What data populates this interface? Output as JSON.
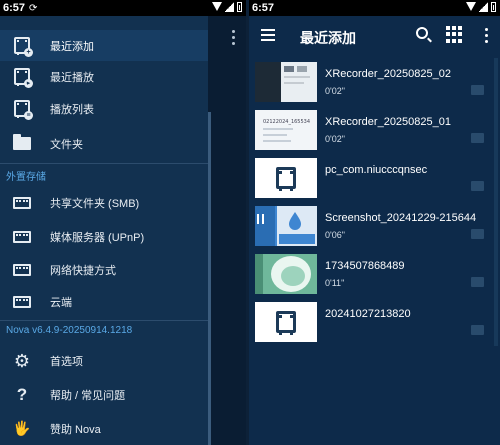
{
  "left_status": {
    "time": "6:57",
    "sync": "⟳"
  },
  "right_status": {
    "time": "6:57"
  },
  "drawer": {
    "items": [
      {
        "label": "最近添加",
        "icon": "recent-add-icon",
        "active": true
      },
      {
        "label": "最近播放",
        "icon": "recent-play-icon",
        "active": false
      },
      {
        "label": "播放列表",
        "icon": "playlist-icon",
        "active": false
      },
      {
        "label": "文件夹",
        "icon": "folder-icon",
        "active": false
      }
    ],
    "external_section": "外置存储",
    "external_items": [
      {
        "label": "共享文件夹 (SMB)",
        "icon": "smb-icon"
      },
      {
        "label": "媒体服务器 (UPnP)",
        "icon": "upnp-icon"
      },
      {
        "label": "网络快捷方式",
        "icon": "network-shortcut-icon"
      },
      {
        "label": "云端",
        "icon": "cloud-icon"
      }
    ],
    "version": "Nova v6.4.9-20250914.1218",
    "bottom_items": [
      {
        "label": "首选项",
        "icon": "gear-icon"
      },
      {
        "label": "帮助 / 常见问题",
        "icon": "help-icon"
      },
      {
        "label": "赞助 Nova",
        "icon": "donate-icon"
      }
    ]
  },
  "appbar": {
    "title": "最近添加"
  },
  "media": [
    {
      "title": "XRecorder_20250825_02",
      "duration": "0'02\"",
      "thumb": "phone-screen"
    },
    {
      "title": "XRecorder_20250825_01",
      "duration": "0'02\"",
      "thumb": "document",
      "thumb_text": "02122024_165534"
    },
    {
      "title": "pc_com.niucccqnsec",
      "duration": "",
      "thumb": "video-placeholder"
    },
    {
      "title": "Screenshot_20241229-215644",
      "duration": "0'06\"",
      "thumb": "screen-capture"
    },
    {
      "title": "1734507868489",
      "duration": "0'11\"",
      "thumb": "green-video"
    },
    {
      "title": "20241027213820",
      "duration": "",
      "thumb": "video-placeholder"
    }
  ],
  "colors": {
    "accent": "#5aa9e6",
    "background": "#0d2a4a",
    "drawer": "#123150"
  }
}
